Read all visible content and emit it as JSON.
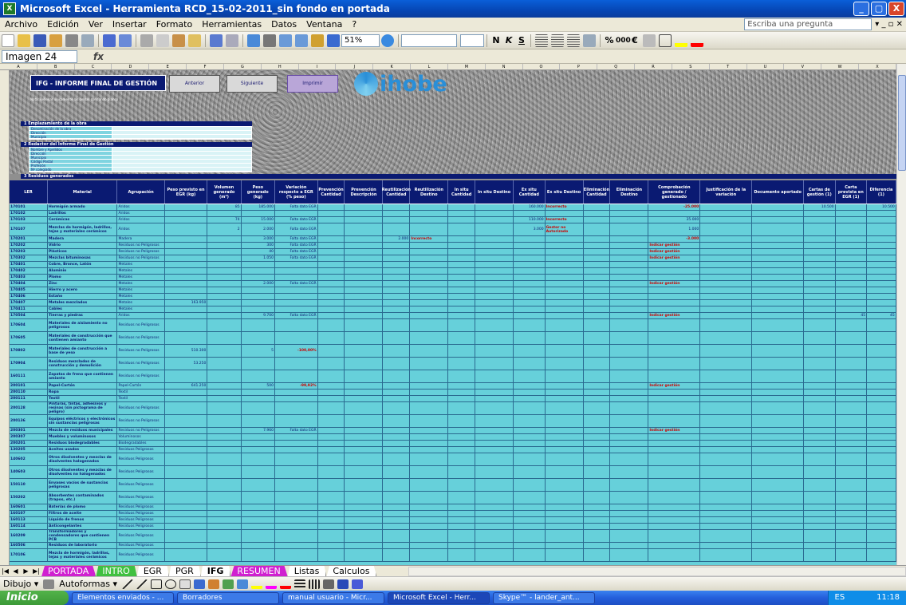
{
  "window": {
    "title": "Microsoft Excel - Herramienta RCD_15-02-2011_sin fondo en portada",
    "min": "_",
    "max": "▢",
    "close": "X"
  },
  "menu": {
    "items": [
      "Archivo",
      "Edición",
      "Ver",
      "Insertar",
      "Formato",
      "Herramientas",
      "Datos",
      "Ventana",
      "?"
    ],
    "ask_placeholder": "Escriba una pregunta"
  },
  "toolbar": {
    "zoom": "51%"
  },
  "formula": {
    "namebox": "Imagen 24",
    "fx": "fx"
  },
  "sheet": {
    "title": "IFG - INFORME FINAL DE GESTIÓN",
    "btn_prev": "Anterior",
    "btn_next": "Siguiente",
    "btn_print": "Imprimir",
    "logo": "ihobe",
    "note": "Nota: Rellenar únicamente las celdas con fondo blanco",
    "sec1": "1  Emplazamiento de la obra",
    "sec1_fields": [
      "Denominación de la obra",
      "Dirección",
      "Municipio"
    ],
    "sec2": "2  Redactor del Informe Final de Gestión",
    "sec2_fields": [
      "Nombre y Apellidos",
      "Dirección",
      "Municipio",
      "Código Postal",
      "Profesión",
      "Nº colegiado"
    ],
    "sec3": "3  Residuos generados"
  },
  "table": {
    "headers": [
      "LER",
      "Material",
      "Agrupación",
      "Peso previsto en EGR (kg)",
      "Volumen generado (m³)",
      "Peso generado (kg)",
      "Variación respecto a EGR (% peso)",
      "Prevención Cantidad",
      "Prevención Descripción",
      "Reutilización Cantidad",
      "Reutilización Destino",
      "In situ Cantidad",
      "In situ Destino",
      "Ex situ Cantidad",
      "Ex situ Destino",
      "Eliminación Cantidad",
      "Eliminación Destino",
      "Comprobación generado / gestionado",
      "Justificación de la variación",
      "Documento aportado",
      "Cartas de gestión (1)",
      "Carta prevista en EGR (1)",
      "Diferencia (1)"
    ],
    "group_gestion": "Gestión (kg)",
    "group_valorizacion": "Valorización",
    "rows": [
      [
        "170101",
        "Hormigón armado",
        "Áridos",
        "",
        "85",
        "185.000",
        "Falta dato EGR",
        "",
        "",
        "",
        "",
        "",
        "",
        "160.000",
        "Incorrecto",
        "",
        "",
        "-25.000",
        "",
        "",
        "10.500",
        "",
        "10.500"
      ],
      [
        "170102",
        "Ladrillos",
        "Áridos",
        "",
        "",
        "",
        "",
        "",
        "",
        "",
        "",
        "",
        "",
        "",
        "",
        "",
        "",
        "",
        "",
        "",
        "",
        "",
        ""
      ],
      [
        "170103",
        "Cerámicas",
        "Áridos",
        "",
        "74",
        "15.000",
        "Falta dato EGR",
        "",
        "",
        "",
        "",
        "",
        "",
        "110.000",
        "Incorrecto",
        "",
        "",
        "35.000",
        "",
        "",
        "",
        "",
        ""
      ],
      [
        "170107",
        "Mezclas de hormigón, ladrillos, tejas y materiales cerámicos",
        "Áridos",
        "",
        "2",
        "2.000",
        "Falta dato EGR",
        "",
        "",
        "",
        "",
        "",
        "",
        "3.000",
        "Gestor no Autorizado",
        "",
        "",
        "1.000",
        "",
        "",
        "",
        "",
        ""
      ],
      [
        "170201",
        "Madera",
        "Madera",
        "",
        "",
        "3.000",
        "Falta dato EGR",
        "",
        "",
        "2.000",
        "Incorrecto",
        "",
        "",
        "",
        "",
        "",
        "",
        "-3.000",
        "",
        "",
        "",
        "",
        ""
      ],
      [
        "170202",
        "Vidrio",
        "Residuos no Peligrosos",
        "",
        "",
        "300",
        "Falta dato EGR",
        "",
        "",
        "",
        "",
        "",
        "",
        "",
        "",
        "",
        "",
        "Indicar gestión",
        "",
        "",
        "",
        "",
        ""
      ],
      [
        "170203",
        "Plásticos",
        "Residuos no Peligrosos",
        "",
        "",
        "40",
        "Falta dato EGR",
        "",
        "",
        "",
        "",
        "",
        "",
        "",
        "",
        "",
        "",
        "Indicar gestión",
        "",
        "",
        "",
        "",
        ""
      ],
      [
        "170302",
        "Mezclas bituminosas",
        "Residuos no Peligrosos",
        "",
        "",
        "1.050",
        "Falta dato EGR",
        "",
        "",
        "",
        "",
        "",
        "",
        "",
        "",
        "",
        "",
        "Indicar gestión",
        "",
        "",
        "",
        "",
        ""
      ],
      [
        "170401",
        "Cobre, Bronce, Latón",
        "Metales",
        "",
        "",
        "",
        "",
        "",
        "",
        "",
        "",
        "",
        "",
        "",
        "",
        "",
        "",
        "",
        "",
        "",
        "",
        "",
        ""
      ],
      [
        "170402",
        "Aluminio",
        "Metales",
        "",
        "",
        "",
        "",
        "",
        "",
        "",
        "",
        "",
        "",
        "",
        "",
        "",
        "",
        "",
        "",
        "",
        "",
        "",
        ""
      ],
      [
        "170403",
        "Plomo",
        "Metales",
        "",
        "",
        "",
        "",
        "",
        "",
        "",
        "",
        "",
        "",
        "",
        "",
        "",
        "",
        "",
        "",
        "",
        "",
        "",
        ""
      ],
      [
        "170404",
        "Zinc",
        "Metales",
        "",
        "",
        "2.000",
        "Falta dato EGR",
        "",
        "",
        "",
        "",
        "",
        "",
        "",
        "",
        "",
        "",
        "Indicar gestión",
        "",
        "",
        "",
        "",
        ""
      ],
      [
        "170405",
        "Hierro y acero",
        "Metales",
        "",
        "",
        "",
        "",
        "",
        "",
        "",
        "",
        "",
        "",
        "",
        "",
        "",
        "",
        "",
        "",
        "",
        "",
        "",
        ""
      ],
      [
        "170406",
        "Estaño",
        "Metales",
        "",
        "",
        "",
        "",
        "",
        "",
        "",
        "",
        "",
        "",
        "",
        "",
        "",
        "",
        "",
        "",
        "",
        "",
        "",
        ""
      ],
      [
        "170407",
        "Metales mezclados",
        "Metales",
        "163.950",
        "",
        "",
        "",
        "",
        "",
        "",
        "",
        "",
        "",
        "",
        "",
        "",
        "",
        "",
        "",
        "",
        "",
        "",
        ""
      ],
      [
        "170411",
        "Cables",
        "Metales",
        "",
        "",
        "",
        "",
        "",
        "",
        "",
        "",
        "",
        "",
        "",
        "",
        "",
        "",
        "",
        "",
        "",
        "",
        "",
        ""
      ],
      [
        "170504",
        "Tierras y piedras",
        "Áridos",
        "",
        "",
        "9.700",
        "Falta dato EGR",
        "",
        "",
        "",
        "",
        "",
        "",
        "",
        "",
        "",
        "",
        "Indicar gestión",
        "",
        "",
        "",
        "45",
        "45"
      ],
      [
        "170604",
        "Materiales de aislamiento no peligrosos",
        "Residuos no Peligrosos",
        "",
        "",
        "",
        "",
        "",
        "",
        "",
        "",
        "",
        "",
        "",
        "",
        "",
        "",
        "",
        "",
        "",
        "",
        "",
        ""
      ],
      [
        "170605",
        "Materiales de construcción que contienen amianto",
        "Residuos no Peligrosos",
        "",
        "",
        "",
        "",
        "",
        "",
        "",
        "",
        "",
        "",
        "",
        "",
        "",
        "",
        "",
        "",
        "",
        "",
        "",
        ""
      ],
      [
        "170802",
        "Materiales de construcción a base de yeso",
        "Residuos no Peligrosos",
        "510.300",
        "",
        "5",
        "-100,00%",
        "",
        "",
        "",
        "",
        "",
        "",
        "",
        "",
        "",
        "",
        "",
        "",
        "",
        "",
        "",
        ""
      ],
      [
        "170904",
        "Residuos mezclados de construcción y demolición",
        "Residuos no Peligrosos",
        "53.250",
        "",
        "",
        "",
        "",
        "",
        "",
        "",
        "",
        "",
        "",
        "",
        "",
        "",
        "",
        "",
        "",
        "",
        "",
        ""
      ],
      [
        "160111",
        "Zapatas de freno que contienen amianto",
        "Residuos no Peligrosos",
        "",
        "",
        "",
        "",
        "",
        "",
        "",
        "",
        "",
        "",
        "",
        "",
        "",
        "",
        "",
        "",
        "",
        "",
        "",
        ""
      ],
      [
        "200101",
        "Papel-Cartón",
        "Papel-Cartón",
        "641.250",
        "",
        "500",
        "-99,92%",
        "",
        "",
        "",
        "",
        "",
        "",
        "",
        "",
        "",
        "",
        "Indicar gestión",
        "",
        "",
        "",
        "",
        ""
      ],
      [
        "200110",
        "Ropa",
        "Textil",
        "",
        "",
        "",
        "",
        "",
        "",
        "",
        "",
        "",
        "",
        "",
        "",
        "",
        "",
        "",
        "",
        "",
        "",
        "",
        ""
      ],
      [
        "200111",
        "Textil",
        "Textil",
        "",
        "",
        "",
        "",
        "",
        "",
        "",
        "",
        "",
        "",
        "",
        "",
        "",
        "",
        "",
        "",
        "",
        "",
        "",
        ""
      ],
      [
        "200128",
        "Pinturas, tintas, adhesivos y resinas (sin pictograma de peligro)",
        "Residuos no Peligrosos",
        "",
        "",
        "",
        "",
        "",
        "",
        "",
        "",
        "",
        "",
        "",
        "",
        "",
        "",
        "",
        "",
        "",
        "",
        "",
        ""
      ],
      [
        "200136",
        "Equipos eléctricos y electrónicos sin sustancias peligrosas",
        "Residuos no Peligrosos",
        "",
        "",
        "",
        "",
        "",
        "",
        "",
        "",
        "",
        "",
        "",
        "",
        "",
        "",
        "",
        "",
        "",
        "",
        "",
        ""
      ],
      [
        "200301",
        "Mezcla de residuos municipales",
        "Residuos no Peligrosos",
        "",
        "",
        "7.960",
        "Falta dato EGR",
        "",
        "",
        "",
        "",
        "",
        "",
        "",
        "",
        "",
        "",
        "Indicar gestión",
        "",
        "",
        "",
        "",
        ""
      ],
      [
        "200307",
        "Muebles y voluminosos",
        "Voluminosos",
        "",
        "",
        "",
        "",
        "",
        "",
        "",
        "",
        "",
        "",
        "",
        "",
        "",
        "",
        "",
        "",
        "",
        "",
        "",
        ""
      ],
      [
        "200201",
        "Residuos biodegradables",
        "Biodegradables",
        "",
        "",
        "",
        "",
        "",
        "",
        "",
        "",
        "",
        "",
        "",
        "",
        "",
        "",
        "",
        "",
        "",
        "",
        "",
        ""
      ],
      [
        "130205",
        "Aceites usados",
        "Residuos Peligrosos",
        "",
        "",
        "",
        "",
        "",
        "",
        "",
        "",
        "",
        "",
        "",
        "",
        "",
        "",
        "",
        "",
        "",
        "",
        "",
        ""
      ],
      [
        "140602",
        "Otros disolventes y mezclas de disolventes halogenados",
        "Residuos Peligrosos",
        "",
        "",
        "",
        "",
        "",
        "",
        "",
        "",
        "",
        "",
        "",
        "",
        "",
        "",
        "",
        "",
        "",
        "",
        "",
        ""
      ],
      [
        "140603",
        "Otros disolventes y mezclas de disolventes no halogenados",
        "Residuos Peligrosos",
        "",
        "",
        "",
        "",
        "",
        "",
        "",
        "",
        "",
        "",
        "",
        "",
        "",
        "",
        "",
        "",
        "",
        "",
        "",
        ""
      ],
      [
        "150110",
        "Envases vacíos de sustancias peligrosas",
        "Residuos Peligrosos",
        "",
        "",
        "",
        "",
        "",
        "",
        "",
        "",
        "",
        "",
        "",
        "",
        "",
        "",
        "",
        "",
        "",
        "",
        "",
        ""
      ],
      [
        "150202",
        "Absorbentes contaminados (trapos, etc.)",
        "Residuos Peligrosos",
        "",
        "",
        "",
        "",
        "",
        "",
        "",
        "",
        "",
        "",
        "",
        "",
        "",
        "",
        "",
        "",
        "",
        "",
        "",
        ""
      ],
      [
        "160601",
        "Baterías de plomo",
        "Residuos Peligrosos",
        "",
        "",
        "",
        "",
        "",
        "",
        "",
        "",
        "",
        "",
        "",
        "",
        "",
        "",
        "",
        "",
        "",
        "",
        "",
        ""
      ],
      [
        "160107",
        "Filtros de aceite",
        "Residuos Peligrosos",
        "",
        "",
        "",
        "",
        "",
        "",
        "",
        "",
        "",
        "",
        "",
        "",
        "",
        "",
        "",
        "",
        "",
        "",
        "",
        ""
      ],
      [
        "160113",
        "Líquido de frenos",
        "Residuos Peligrosos",
        "",
        "",
        "",
        "",
        "",
        "",
        "",
        "",
        "",
        "",
        "",
        "",
        "",
        "",
        "",
        "",
        "",
        "",
        "",
        ""
      ],
      [
        "160114",
        "Anticongelantes",
        "Residuos Peligrosos",
        "",
        "",
        "",
        "",
        "",
        "",
        "",
        "",
        "",
        "",
        "",
        "",
        "",
        "",
        "",
        "",
        "",
        "",
        "",
        ""
      ],
      [
        "160209",
        "Transformadores y condensadores que contienen PCB",
        "Residuos Peligrosos",
        "",
        "",
        "",
        "",
        "",
        "",
        "",
        "",
        "",
        "",
        "",
        "",
        "",
        "",
        "",
        "",
        "",
        "",
        "",
        ""
      ],
      [
        "160506",
        "Residuos de laboratorio",
        "Residuos Peligrosos",
        "",
        "",
        "",
        "",
        "",
        "",
        "",
        "",
        "",
        "",
        "",
        "",
        "",
        "",
        "",
        "",
        "",
        "",
        "",
        ""
      ],
      [
        "170106",
        "Mezcla de hormigón, ladrillos, tejas y materiales cerámicos",
        "Residuos Peligrosos",
        "",
        "",
        "",
        "",
        "",
        "",
        "",
        "",
        "",
        "",
        "",
        "",
        "",
        "",
        "",
        "",
        "",
        "",
        "",
        ""
      ]
    ]
  },
  "sheet_tabs": [
    "PORTADA",
    "INTRO",
    "EGR",
    "PGR",
    "IFG",
    "RESUMEN",
    "Listas",
    "Calculos"
  ],
  "active_tab": "IFG",
  "drawbar": {
    "dibujo": "Dibujo ▾",
    "autoformas": "Autoformas ▾"
  },
  "taskbar": {
    "start": "Inicio",
    "tasks": [
      "Elementos enviados - ...",
      "Borradores",
      "manual usuario - Micr...",
      "Microsoft Excel - Herr...",
      "Skype™ - lander_ant..."
    ],
    "active_task": 3,
    "tray_lang": "ES",
    "time": "11:18"
  }
}
